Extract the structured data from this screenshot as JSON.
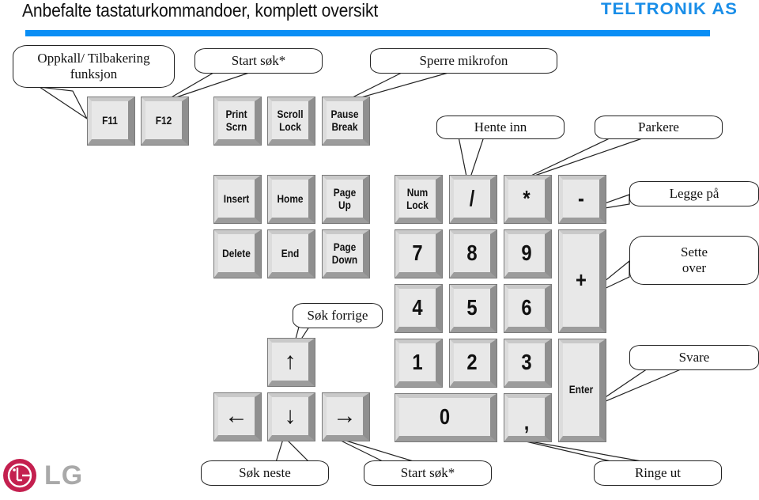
{
  "header": {
    "title": "Anbefalte tastaturkommandoer, komplett oversikt",
    "brand": "TELTRONIK AS",
    "rule_color": "#0a8ef5",
    "brand_color": "#1a8ee8"
  },
  "keys": {
    "f11": "F11",
    "f12": "F12",
    "print_scrn": "Print\nScrn",
    "scroll_lock": "Scroll\nLock",
    "pause_break": "Pause\nBreak",
    "insert": "Insert",
    "home": "Home",
    "page_up": "Page\nUp",
    "delete": "Delete",
    "end": "End",
    "page_down": "Page\nDown",
    "num_lock": "Num\nLock",
    "divide": "/",
    "multiply": "*",
    "minus": "-",
    "plus": "+",
    "enter": "Enter",
    "n7": "7",
    "n8": "8",
    "n9": "9",
    "n4": "4",
    "n5": "5",
    "n6": "6",
    "n1": "1",
    "n2": "2",
    "n3": "3",
    "n0": "0",
    "decimal": ",",
    "arrow_up": "↑",
    "arrow_left": "←",
    "arrow_down": "↓",
    "arrow_right": "→"
  },
  "callouts": {
    "recall": "Oppkall/ Tilbakering\nfunksjon",
    "start_search_top": "Start søk*",
    "mute_mic": "Sperre mikrofon",
    "retrieve": "Hente inn",
    "park": "Parkere",
    "hang_up": "Legge på",
    "transfer": "Sette\nover",
    "search_prev": "Søk forrige",
    "answer": "Svare",
    "search_next": "Søk neste",
    "start_search_bottom": "Start søk*",
    "dial_out": "Ringe ut"
  },
  "footer": {
    "logo_text": "LG",
    "logo_color": "#c4204f"
  }
}
